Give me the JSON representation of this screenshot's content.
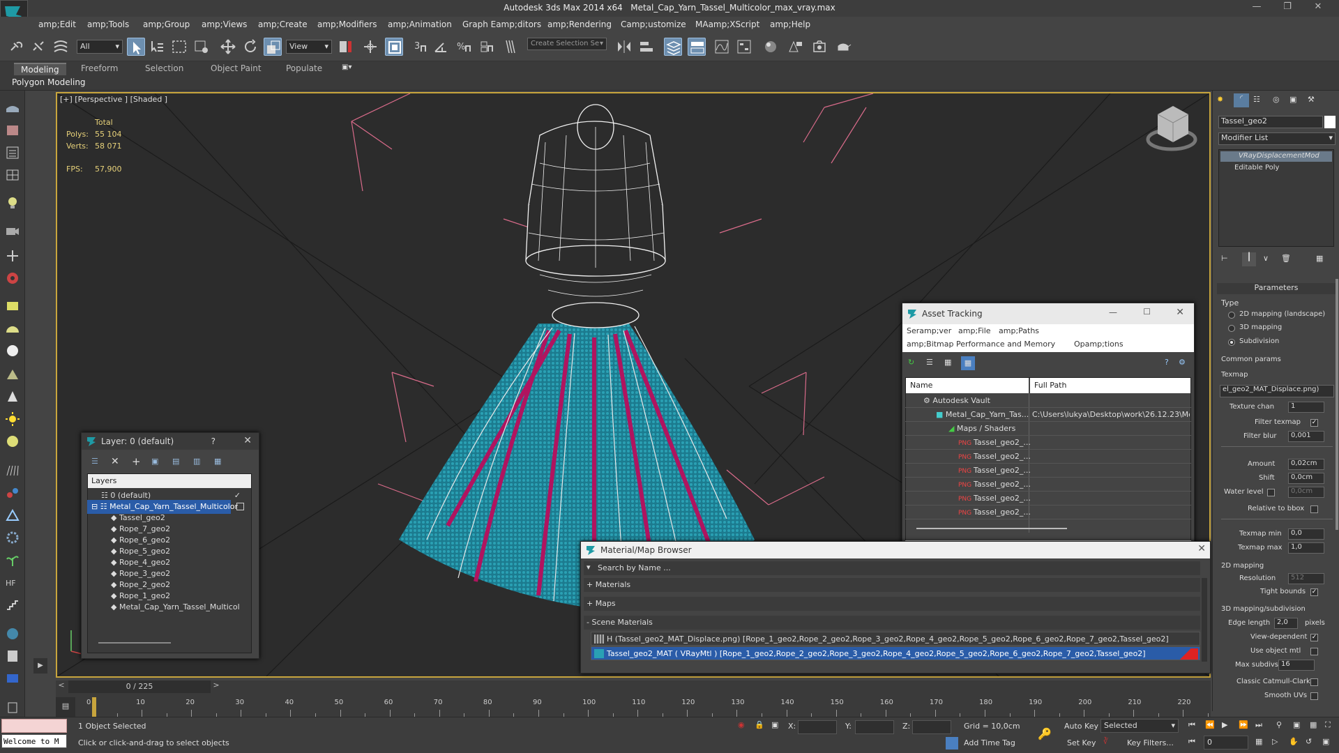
{
  "window": {
    "app_title": "Autodesk 3ds Max  2014 x64",
    "file_title": "Metal_Cap_Yarn_Tassel_Multicolor_max_vray.max"
  },
  "menubar": [
    "amp;Edit",
    "amp;Tools",
    "amp;Group",
    "amp;Views",
    "amp;Create",
    "amp;Modifiers",
    "amp;Animation",
    "Graph Eamp;ditors",
    "amp;Rendering",
    "Camp;ustomize",
    "MAamp;XScript",
    "amp;Help"
  ],
  "toolbar": {
    "filter_value": "All",
    "view_value": "View",
    "selection_set_placeholder": "Create Selection Se"
  },
  "ribbon": {
    "tabs": [
      "Modeling",
      "Freeform",
      "Selection",
      "Object Paint",
      "Populate"
    ],
    "active": "Modeling",
    "sub_label": "Polygon Modeling"
  },
  "viewport": {
    "label": "[+] [Perspective ] [Shaded ]",
    "stats_header": "Total",
    "polys_label": "Polys:",
    "polys_value": "55 104",
    "verts_label": "Verts:",
    "verts_value": "58 071",
    "fps_label": "FPS:",
    "fps_value": "57,900"
  },
  "layer_window": {
    "title": "Layer: 0 (default)",
    "help": "?",
    "column": "Layers",
    "rows": [
      {
        "label": "0 (default)",
        "selected": false,
        "check": "✓"
      },
      {
        "label": "Metal_Cap_Yarn_Tassel_Multicolor",
        "selected": true,
        "check": ""
      },
      {
        "label": "Tassel_geo2"
      },
      {
        "label": "Rope_7_geo2"
      },
      {
        "label": "Rope_6_geo2"
      },
      {
        "label": "Rope_5_geo2"
      },
      {
        "label": "Rope_4_geo2"
      },
      {
        "label": "Rope_3_geo2"
      },
      {
        "label": "Rope_2_geo2"
      },
      {
        "label": "Rope_1_geo2"
      },
      {
        "label": "Metal_Cap_Yarn_Tassel_Multicol"
      }
    ]
  },
  "asset_window": {
    "title": "Asset Tracking",
    "menu": [
      "Seramp;ver",
      "amp;File",
      "amp;Paths",
      "amp;Bitmap Performance and Memory",
      "Opamp;tions"
    ],
    "col_name": "Name",
    "col_path": "Full Path",
    "rows": [
      {
        "name": "Autodesk Vault",
        "path": ""
      },
      {
        "name": "Metal_Cap_Yarn_Tas...",
        "path": "C:\\Users\\lukya\\Desktop\\work\\26.12.23\\Met"
      },
      {
        "name": "Maps / Shaders",
        "path": ""
      },
      {
        "name": "Tassel_geo2_...",
        "path": ""
      },
      {
        "name": "Tassel_geo2_...",
        "path": ""
      },
      {
        "name": "Tassel_geo2_...",
        "path": ""
      },
      {
        "name": "Tassel_geo2_...",
        "path": ""
      },
      {
        "name": "Tassel_geo2_...",
        "path": ""
      },
      {
        "name": "Tassel_geo2_...",
        "path": ""
      }
    ]
  },
  "material_browser": {
    "title": "Material/Map Browser",
    "search_placeholder": "Search by Name ...",
    "groups": [
      "+ Materials",
      "+ Maps",
      "- Scene Materials"
    ],
    "items": [
      "H (Tassel_geo2_MAT_Displace.png) [Rope_1_geo2,Rope_2_geo2,Rope_3_geo2,Rope_4_geo2,Rope_5_geo2,Rope_6_geo2,Rope_7_geo2,Tassel_geo2]",
      "Tassel_geo2_MAT ( VRayMtl ) [Rope_1_geo2,Rope_2_geo2,Rope_3_geo2,Rope_4_geo2,Rope_5_geo2,Rope_6_geo2,Rope_7_geo2,Tassel_geo2]"
    ]
  },
  "command_panel": {
    "object_name": "Tassel_geo2",
    "modifier_list": "Modifier List",
    "stack": [
      "VRayDisplacementMod",
      "Editable Poly"
    ],
    "rollout": "Parameters",
    "type_label": "Type",
    "type_options": [
      "2D mapping (landscape)",
      "3D mapping",
      "Subdivision"
    ],
    "type_selected": 2,
    "common_params": "Common params",
    "texmap_label": "Texmap",
    "texmap_value": "el_geo2_MAT_Displace.png)",
    "texture_chan_label": "Texture chan",
    "texture_chan": "1",
    "filter_texmap_label": "Filter texmap",
    "filter_blur_label": "Filter blur",
    "filter_blur": "0,001",
    "amount_label": "Amount",
    "amount": "0,02cm",
    "shift_label": "Shift",
    "shift": "0,0cm",
    "water_label": "Water level",
    "water": "0,0cm",
    "relative_label": "Relative to bbox",
    "texmap_min_label": "Texmap min",
    "texmap_min": "0,0",
    "texmap_max_label": "Texmap max",
    "texmap_max": "1,0",
    "mapping2d": "2D mapping",
    "resolution_label": "Resolution",
    "resolution": "512",
    "tight_label": "Tight bounds",
    "mapping3d": "3D mapping/subdivision",
    "edge_label": "Edge length",
    "edge": "2,0",
    "pixels": "pixels",
    "view_dep": "View-dependent",
    "use_obj_mtl": "Use object mtl",
    "max_subdivs_label": "Max subdivs",
    "max_subdivs": "16",
    "catmull": "Classic Catmull-Clark",
    "smooth_uvs": "Smooth UVs"
  },
  "timeline": {
    "frame": "0 / 225",
    "ticks": [
      "0",
      "10",
      "20",
      "30",
      "40",
      "50",
      "60",
      "70",
      "80",
      "90",
      "100",
      "110",
      "120",
      "130",
      "140",
      "150",
      "160",
      "170",
      "180",
      "190",
      "200",
      "210",
      "220"
    ]
  },
  "status": {
    "welcome": "Welcome to M",
    "selected": "1 Object Selected",
    "hint": "Click or click-and-drag to select objects",
    "x": "X:",
    "y": "Y:",
    "z": "Z:",
    "grid": "Grid = 10,0cm",
    "add_time_tag": "Add Time Tag",
    "auto_key": "Auto Key",
    "set_key": "Set Key",
    "key_mode": "Selected",
    "key_filters": "Key Filters...",
    "frame_value": "0"
  },
  "colors": {
    "accent": "#c8a53d",
    "selection": "#2a5ca8",
    "yarn_teal": "#1f8aa0",
    "yarn_magenta": "#c0186e"
  }
}
